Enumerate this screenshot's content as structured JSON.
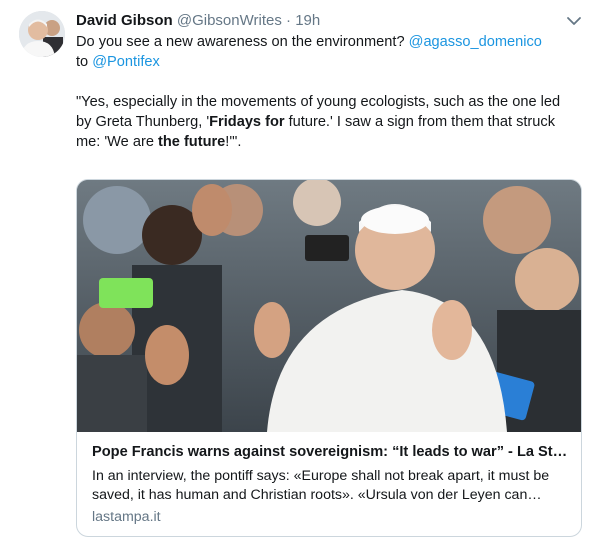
{
  "tweet": {
    "author_name": "David Gibson",
    "author_handle": "@GibsonWrites",
    "separator": "·",
    "timestamp": "19h",
    "line1_text": "Do you see a new awareness on the environment? ",
    "line1_mention": "@agasso_domenico",
    "line2_prefix": "to ",
    "line2_mention": "@Pontifex",
    "quote_part1": "\"Yes, especially in the movements of young ecologists, such as the one led by Greta Thunberg, '",
    "quote_bold1": "Fridays for",
    "quote_part2": " future.' I saw a sign from them that struck me: 'We are ",
    "quote_bold2": "the future",
    "quote_part3": "!'\".",
    "menu_icon": "chevron-down-icon"
  },
  "card": {
    "title": "Pope Francis warns against sovereignism: “It leads to war” - La Sta...",
    "description": "In an interview, the pontiff says: «Europe shall not break apart, it must be saved, it has human and Christian roots». «Ursula von der Leyen can reviv...",
    "domain": "lastampa.it"
  },
  "colors": {
    "link": "#1b95e0",
    "secondary_text": "#657786",
    "card_border": "#ccd6dd"
  }
}
